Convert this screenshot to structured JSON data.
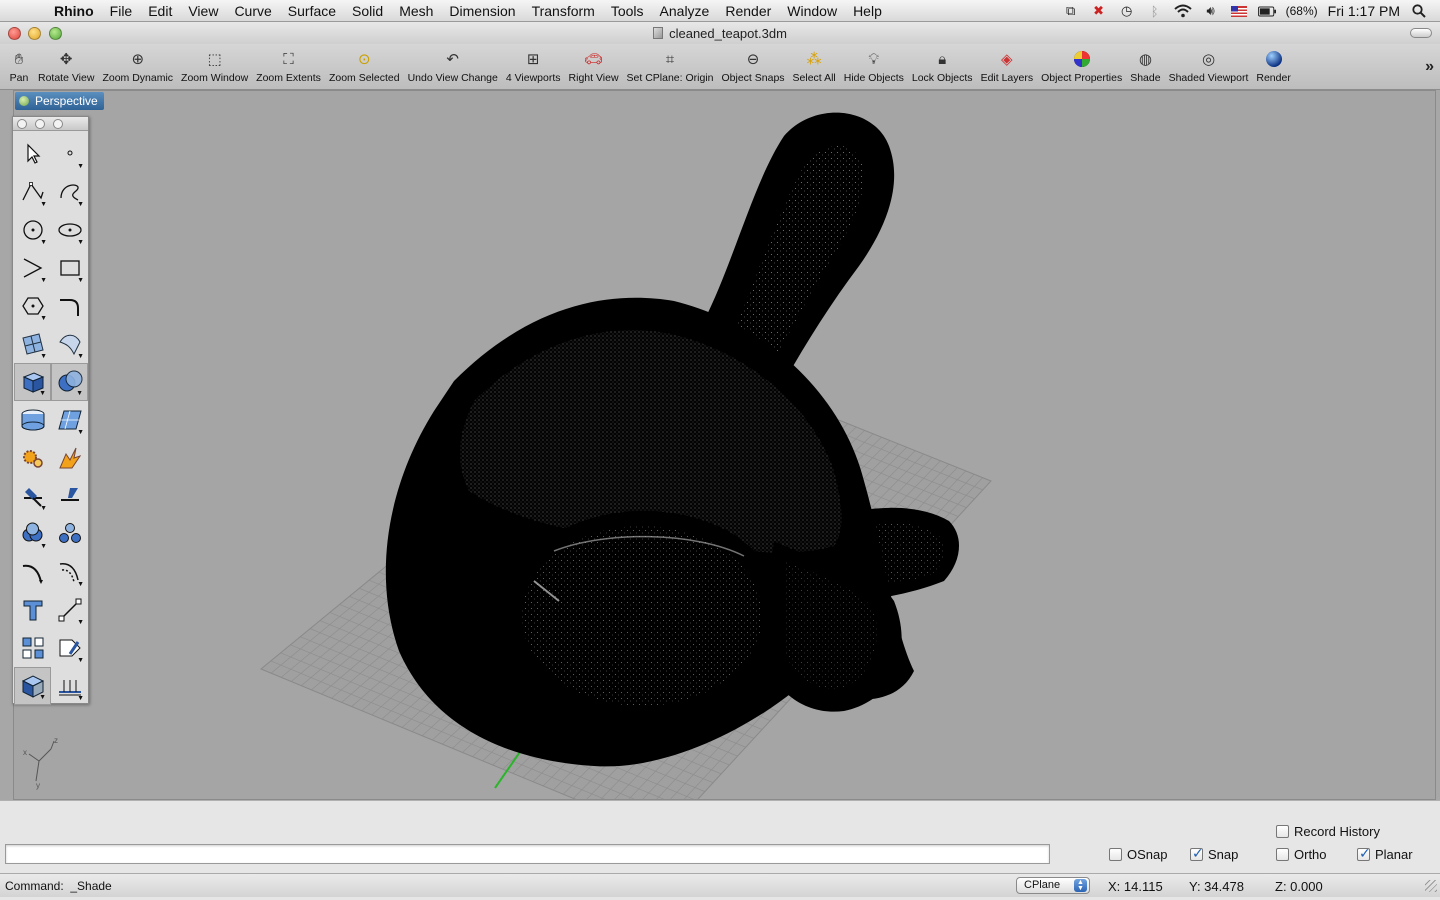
{
  "menubar": {
    "app": "Rhino",
    "items": [
      "File",
      "Edit",
      "View",
      "Curve",
      "Surface",
      "Solid",
      "Mesh",
      "Dimension",
      "Transform",
      "Tools",
      "Analyze",
      "Render",
      "Window",
      "Help"
    ],
    "battery": "(68%)",
    "clock": "Fri 1:17 PM"
  },
  "window": {
    "title": "cleaned_teapot.3dm"
  },
  "toolbar": {
    "tools": [
      {
        "label": "Pan",
        "icon": "hand-icon"
      },
      {
        "label": "Rotate View",
        "icon": "rotate-view-icon"
      },
      {
        "label": "Zoom Dynamic",
        "icon": "zoom-dynamic-icon"
      },
      {
        "label": "Zoom Window",
        "icon": "zoom-window-icon"
      },
      {
        "label": "Zoom Extents",
        "icon": "zoom-extents-icon"
      },
      {
        "label": "Zoom Selected",
        "icon": "zoom-selected-icon"
      },
      {
        "label": "Undo View Change",
        "icon": "undo-view-icon"
      },
      {
        "label": "4 Viewports",
        "icon": "four-viewports-icon"
      },
      {
        "label": "Right View",
        "icon": "right-view-icon"
      },
      {
        "label": "Set CPlane: Origin",
        "icon": "cplane-origin-icon"
      },
      {
        "label": "Object Snaps",
        "icon": "object-snaps-icon"
      },
      {
        "label": "Select All",
        "icon": "select-all-icon"
      },
      {
        "label": "Hide Objects",
        "icon": "hide-objects-icon"
      },
      {
        "label": "Lock Objects",
        "icon": "lock-icon"
      },
      {
        "label": "Edit Layers",
        "icon": "layers-icon"
      },
      {
        "label": "Object Properties",
        "icon": "color-wheel-icon"
      },
      {
        "label": "Shade",
        "icon": "shade-sphere-icon"
      },
      {
        "label": "Shaded Viewport",
        "icon": "shaded-viewport-icon"
      },
      {
        "label": "Render",
        "icon": "render-sphere-icon"
      }
    ]
  },
  "viewport": {
    "name": "Perspective"
  },
  "command": {
    "input_value": "",
    "prompt_label": "Command:",
    "last_command": "_Shade"
  },
  "toggles": {
    "record_history": {
      "label": "Record History",
      "checked": false
    },
    "osnap": {
      "label": "OSnap",
      "checked": false
    },
    "snap": {
      "label": "Snap",
      "checked": true
    },
    "ortho": {
      "label": "Ortho",
      "checked": false
    },
    "planar": {
      "label": "Planar",
      "checked": true
    }
  },
  "status": {
    "cplane": "CPlane",
    "x": "X: 14.115",
    "y": "Y: 34.478",
    "z": "Z: 0.000"
  },
  "colors": {
    "viewport_bg": "#a5a5a5",
    "tab_blue": "#2f6296",
    "mesh": "#000000",
    "grid_line": "#8f8f8f",
    "y_axis": "#2bb52b"
  }
}
